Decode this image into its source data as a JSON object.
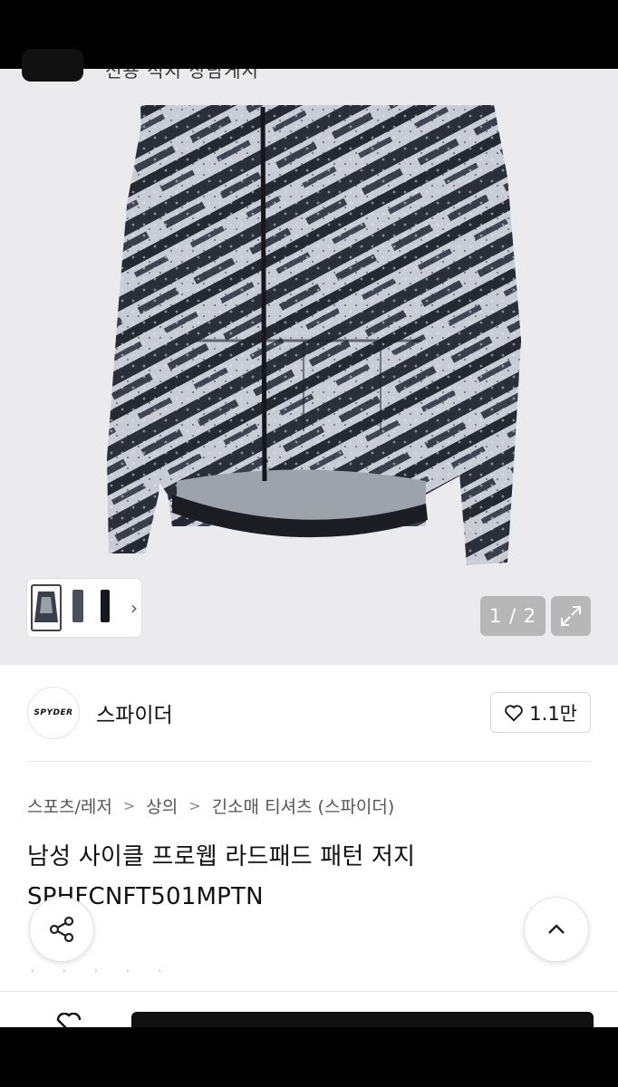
{
  "topbar": {
    "peek_text": "전용 적지 상담게시"
  },
  "gallery": {
    "counter": "1 / 2",
    "thumbs_more": "›"
  },
  "brand": {
    "logo_text": "SPYDER",
    "name": "스파이더",
    "like_count": "1.1만"
  },
  "breadcrumb": [
    "스포츠/레저",
    "상의",
    "긴소매 티셔츠 (스파이더)"
  ],
  "product": {
    "title": "남성 사이클 프로웹 라드패드 패턴 저지 SPHFCNFT501MPTN"
  },
  "icons": {
    "heart": "heart-icon",
    "expand": "expand-icon",
    "share": "share-icon",
    "scroll_top": "chevron-up-icon",
    "breadcrumb_sep": "chevron-right-icon"
  },
  "colors": {
    "background": "#ffffff",
    "gallery_bg": "#ebebed",
    "text": "#111111",
    "muted": "#555555",
    "jersey_dark": "#2b2f3a",
    "jersey_light": "#c9ccd4"
  }
}
